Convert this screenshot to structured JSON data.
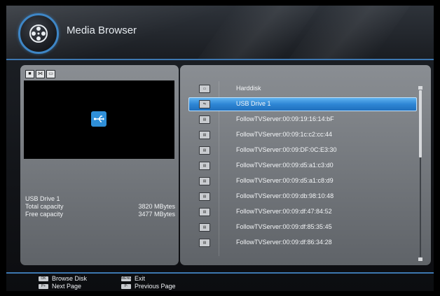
{
  "header": {
    "title": "Media Browser",
    "logo_icon": "film-reel-icon",
    "accent": "#3d77b0"
  },
  "left_panel": {
    "toolbar_icons": [
      "stop-icon",
      "network-icon",
      "folder-icon"
    ],
    "preview_icon": "usb-icon",
    "device_name": "USB Drive 1",
    "total_capacity_label": "Total capacity",
    "total_capacity_value": "3820 MBytes",
    "free_capacity_label": "Free capacity",
    "free_capacity_value": "3477 MBytes"
  },
  "device_list": {
    "selected_index": 1,
    "items": [
      {
        "label": "Harddisk",
        "icon": "harddisk-icon"
      },
      {
        "label": "USB Drive 1",
        "icon": "usb-icon"
      },
      {
        "label": "FollowTVServer:00:09:19:16:14:bF",
        "icon": "server-icon"
      },
      {
        "label": "FollowTVServer:00:09:1c:c2:cc:44",
        "icon": "server-icon"
      },
      {
        "label": "FollowTVServer:00:09:DF:0C:E3:30",
        "icon": "server-icon"
      },
      {
        "label": "FollowTVServer:00:09:d5:a1:c3:d0",
        "icon": "server-icon"
      },
      {
        "label": "FollowTVServer:00:09:d5:a1:c8:d9",
        "icon": "server-icon"
      },
      {
        "label": "FollowTVServer:00:09:db:98:10:48",
        "icon": "server-icon"
      },
      {
        "label": "FollowTVServer:00:09:df:47:84:52",
        "icon": "server-icon"
      },
      {
        "label": "FollowTVServer:00:09:df:85:35:45",
        "icon": "server-icon"
      },
      {
        "label": "FollowTVServer:00:09:df:86:34:28",
        "icon": "server-icon"
      }
    ]
  },
  "footer": {
    "browse_key": "OK",
    "browse_label": "Browse Disk",
    "next_key": "P+",
    "next_label": "Next Page",
    "exit_key": "MENU",
    "exit_label": "Exit",
    "prev_key": "P-",
    "prev_label": "Previous Page"
  }
}
